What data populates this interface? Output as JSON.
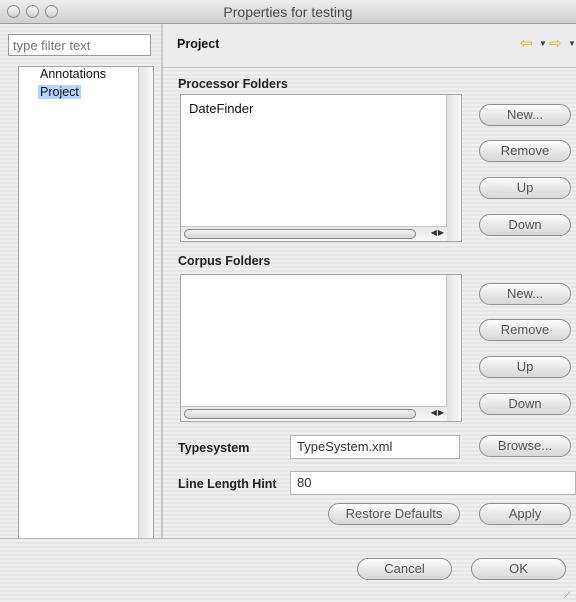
{
  "window": {
    "title": "Properties for testing"
  },
  "left": {
    "filter_placeholder": "type filter text",
    "tree_items": [
      "Annotations",
      "Project"
    ],
    "selected_item": "Project"
  },
  "page": {
    "title": "Project",
    "processor_folders": {
      "label": "Processor Folders",
      "items": [
        "DateFinder"
      ],
      "buttons": {
        "new": "New...",
        "remove": "Remove",
        "up": "Up",
        "down": "Down"
      }
    },
    "corpus_folders": {
      "label": "Corpus Folders",
      "items": [],
      "buttons": {
        "new": "New...",
        "remove": "Remove",
        "up": "Up",
        "down": "Down"
      }
    },
    "typesystem": {
      "label": "Typesystem",
      "value": "TypeSystem.xml",
      "browse": "Browse..."
    },
    "line_length_hint": {
      "label": "Line Length Hint",
      "value": "80"
    },
    "restore_defaults": "Restore Defaults",
    "apply": "Apply"
  },
  "footer": {
    "cancel": "Cancel",
    "ok": "OK"
  },
  "icons": {
    "nav_back": "arrow-left-icon",
    "nav_forward": "arrow-right-icon",
    "accent": "#f0b400",
    "selection": "#b5d5ff"
  }
}
